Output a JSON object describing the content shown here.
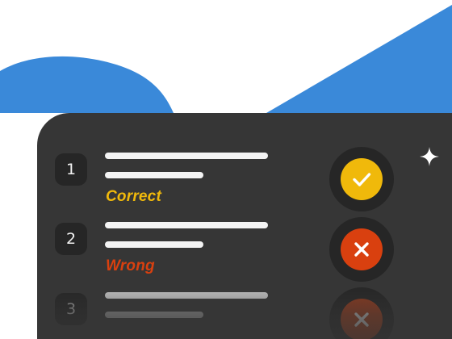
{
  "colors": {
    "background": "#ffffff",
    "blue_shape": "#3a89d9",
    "card": "#363636",
    "badge": "#262626",
    "correct": "#f0b90b",
    "wrong": "#d9400f",
    "sparkle": "#ffffff"
  },
  "questions": [
    {
      "number": "1",
      "status": "correct",
      "label": "Correct",
      "icon": "check-icon"
    },
    {
      "number": "2",
      "status": "wrong",
      "label": "Wrong",
      "icon": "close-icon"
    },
    {
      "number": "3",
      "status": "wrong",
      "label": "",
      "icon": "close-icon"
    }
  ],
  "decorations": [
    "sparkle-icon",
    "sparkle-icon"
  ]
}
